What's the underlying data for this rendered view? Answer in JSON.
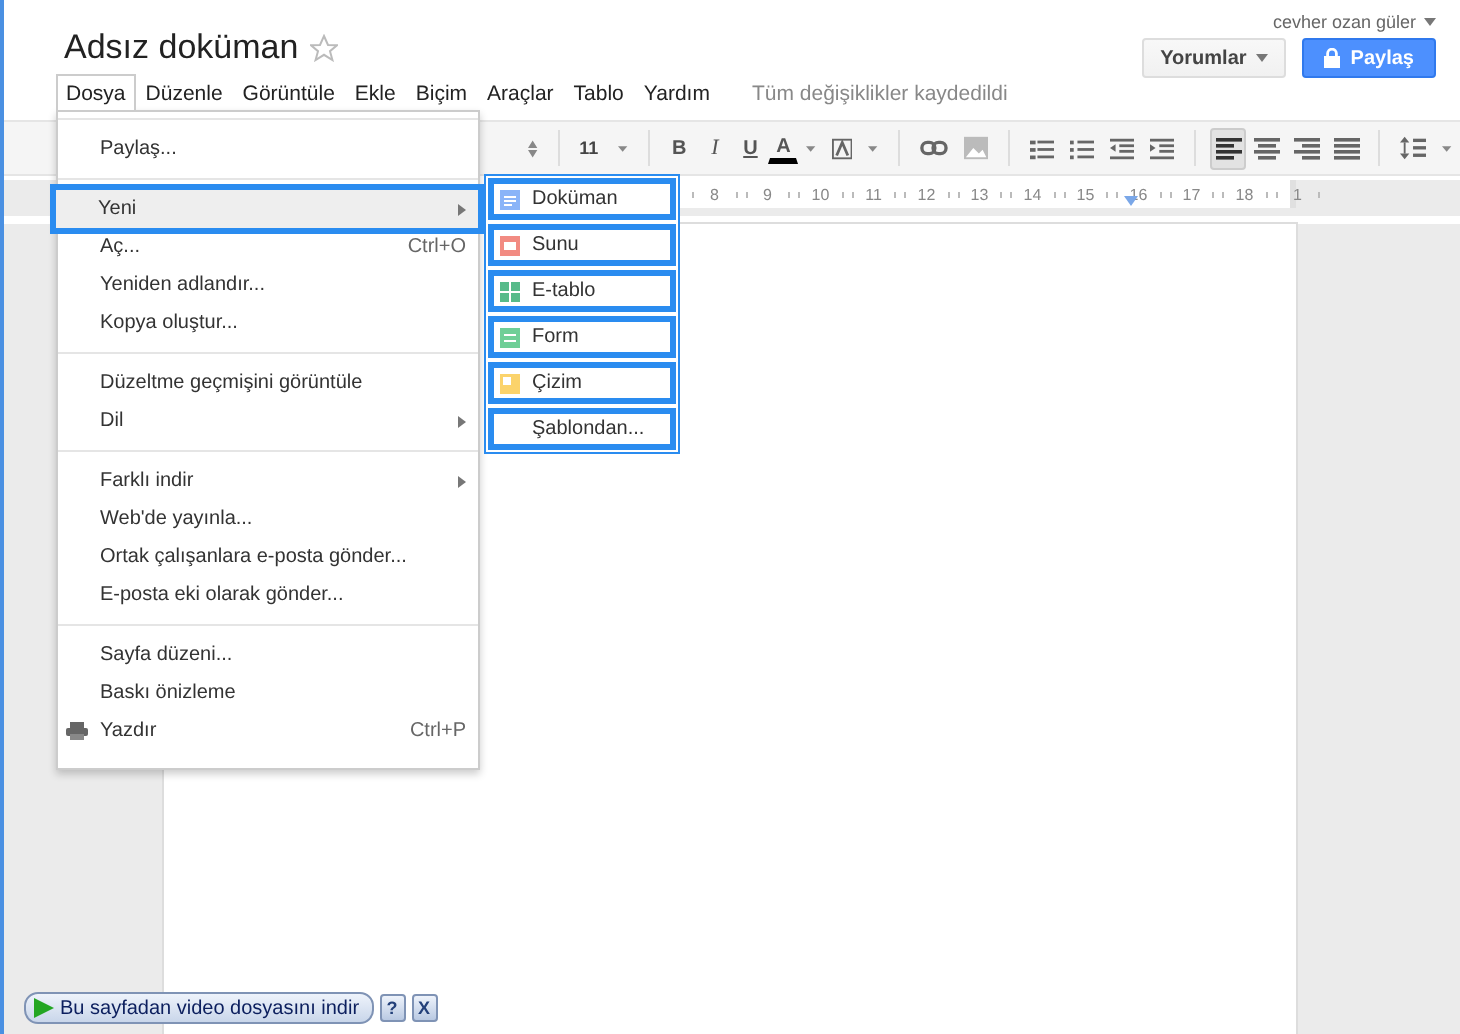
{
  "document": {
    "title": "Adsız doküman",
    "starred": false
  },
  "account": {
    "user": "cevher ozan güler"
  },
  "buttons": {
    "comments": "Yorumlar",
    "share": "Paylaş"
  },
  "menubar": {
    "items": [
      {
        "label": "Dosya",
        "selected": true
      },
      {
        "label": "Düzenle",
        "selected": false
      },
      {
        "label": "Görüntüle",
        "selected": false
      },
      {
        "label": "Ekle",
        "selected": false
      },
      {
        "label": "Biçim",
        "selected": false
      },
      {
        "label": "Araçlar",
        "selected": false
      },
      {
        "label": "Tablo",
        "selected": false
      },
      {
        "label": "Yardım",
        "selected": false
      }
    ],
    "save_status": "Tüm değişiklikler kaydedildi"
  },
  "toolbar": {
    "font_size": "11",
    "format": [
      {
        "label": "B",
        "kind": "bold"
      },
      {
        "label": "I",
        "kind": "italic"
      },
      {
        "label": "U",
        "kind": "underline"
      },
      {
        "label": "A",
        "kind": "color"
      }
    ],
    "alignment": [
      {
        "kind": "left",
        "selected": true
      },
      {
        "kind": "center",
        "selected": false
      },
      {
        "kind": "right",
        "selected": false
      },
      {
        "kind": "justify",
        "selected": false
      }
    ]
  },
  "ruler": {
    "marks": [
      "8",
      "9",
      "10",
      "11",
      "12",
      "13",
      "14",
      "15",
      "16",
      "17",
      "18",
      "1"
    ]
  },
  "file_menu": {
    "groups": [
      {
        "items": [
          {
            "label": "Paylaş...",
            "submenu": false,
            "selected": false
          }
        ]
      },
      {
        "items": [
          {
            "label": "Yeni",
            "submenu": true,
            "selected": true
          },
          {
            "label": "Aç...",
            "shortcut": "Ctrl+O",
            "submenu": false,
            "selected": false
          },
          {
            "label": "Yeniden adlandır...",
            "submenu": false,
            "selected": false
          },
          {
            "label": "Kopya oluştur...",
            "submenu": false,
            "selected": false
          }
        ]
      },
      {
        "items": [
          {
            "label": "Düzeltme geçmişini görüntüle",
            "submenu": false,
            "selected": false
          },
          {
            "label": "Dil",
            "submenu": true,
            "selected": false
          }
        ]
      },
      {
        "items": [
          {
            "label": "Farklı indir",
            "submenu": true,
            "selected": false
          },
          {
            "label": "Web'de yayınla...",
            "submenu": false,
            "selected": false
          },
          {
            "label": "Ortak çalışanlara e-posta gönder...",
            "submenu": false,
            "selected": false
          },
          {
            "label": "E-posta eki olarak gönder...",
            "submenu": false,
            "selected": false
          }
        ]
      },
      {
        "items": [
          {
            "label": "Sayfa düzeni...",
            "submenu": false,
            "selected": false
          },
          {
            "label": "Baskı önizleme",
            "submenu": false,
            "selected": false
          },
          {
            "label": "Yazdır",
            "shortcut": "Ctrl+P",
            "kind": "print",
            "submenu": false,
            "selected": false
          }
        ]
      }
    ]
  },
  "new_submenu": {
    "items": [
      {
        "label": "Doküman",
        "kind": "document"
      },
      {
        "label": "Sunu",
        "kind": "presentation"
      },
      {
        "label": "E-tablo",
        "kind": "spreadsheet"
      },
      {
        "label": "Form",
        "kind": "form"
      },
      {
        "label": "Çizim",
        "kind": "drawing"
      },
      {
        "label": "Şablondan...",
        "kind": "template"
      }
    ]
  },
  "addon_bar": {
    "label": "Bu sayfadan video dosyasını indir",
    "help": "?",
    "close": "X"
  }
}
